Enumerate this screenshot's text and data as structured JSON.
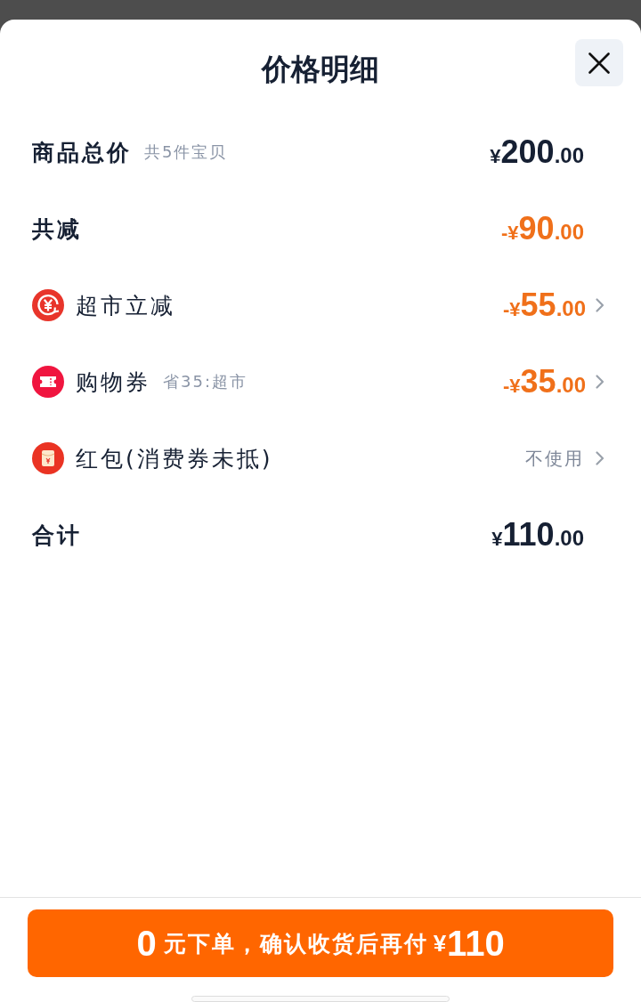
{
  "sheet": {
    "title": "价格明细"
  },
  "rows": [
    {
      "kind": "goods-total",
      "label": "商品总价",
      "note": "共5件宝贝",
      "amount": {
        "currency": "¥",
        "integer": "200",
        "fraction": ".00"
      }
    },
    {
      "kind": "reduction-total",
      "label": "共减",
      "amount": {
        "sign": "-",
        "currency": "¥",
        "integer": "90",
        "fraction": ".00"
      }
    },
    {
      "kind": "store-discount",
      "label": "超市立减",
      "amount": {
        "sign": "-",
        "currency": "¥",
        "integer": "55",
        "fraction": ".00"
      }
    },
    {
      "kind": "coupon",
      "label": "购物券",
      "note": "省35:超市",
      "amount": {
        "sign": "-",
        "currency": "¥",
        "integer": "35",
        "fraction": ".00"
      }
    },
    {
      "kind": "red-packet",
      "label": "红包(消费券未抵)",
      "value": "不使用"
    },
    {
      "kind": "sum",
      "label": "合计",
      "amount": {
        "currency": "¥",
        "integer": "110",
        "fraction": ".00"
      }
    }
  ],
  "pay_button": {
    "amount_now": "0",
    "text": "元下单，确认收货后再付",
    "currency": "¥",
    "amount_later": "110"
  }
}
